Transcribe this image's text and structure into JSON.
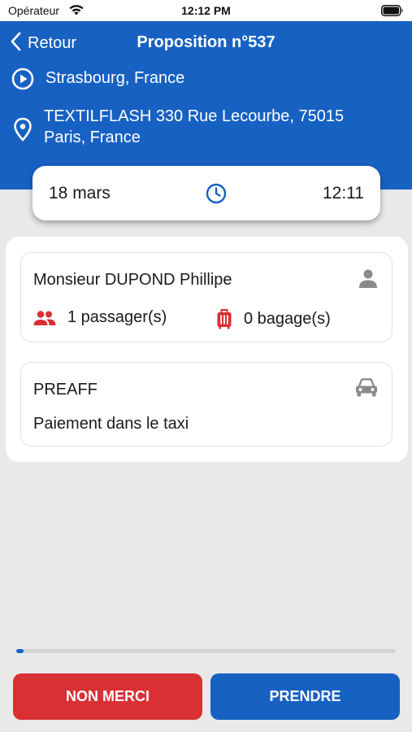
{
  "status_bar": {
    "carrier": "Opérateur",
    "time": "12:12 PM"
  },
  "header": {
    "back_label": "Retour",
    "title": "Proposition n°537",
    "origin": "Strasbourg, France",
    "destination": "TEXTILFLASH 330 Rue Lecourbe, 75015 Paris, France"
  },
  "schedule": {
    "date": "18 mars",
    "time": "12:11"
  },
  "client": {
    "name": "Monsieur DUPOND Phillipe",
    "passengers": "1 passager(s)",
    "luggage": "0 bagage(s)"
  },
  "vehicle": {
    "category": "PREAFF",
    "payment": "Paiement dans le taxi"
  },
  "timer": {
    "progress_fraction": 0.02
  },
  "actions": {
    "decline": "NON MERCI",
    "accept": "PRENDRE"
  },
  "colors": {
    "primary": "#1761c3",
    "danger": "#d93034",
    "icon_grey": "#8a8a8e"
  },
  "icons": [
    "wifi-icon",
    "battery-icon",
    "chevron-left-icon",
    "play-circle-icon",
    "location-pin-icon",
    "clock-icon",
    "person-icon",
    "group-icon",
    "luggage-icon",
    "car-icon"
  ]
}
